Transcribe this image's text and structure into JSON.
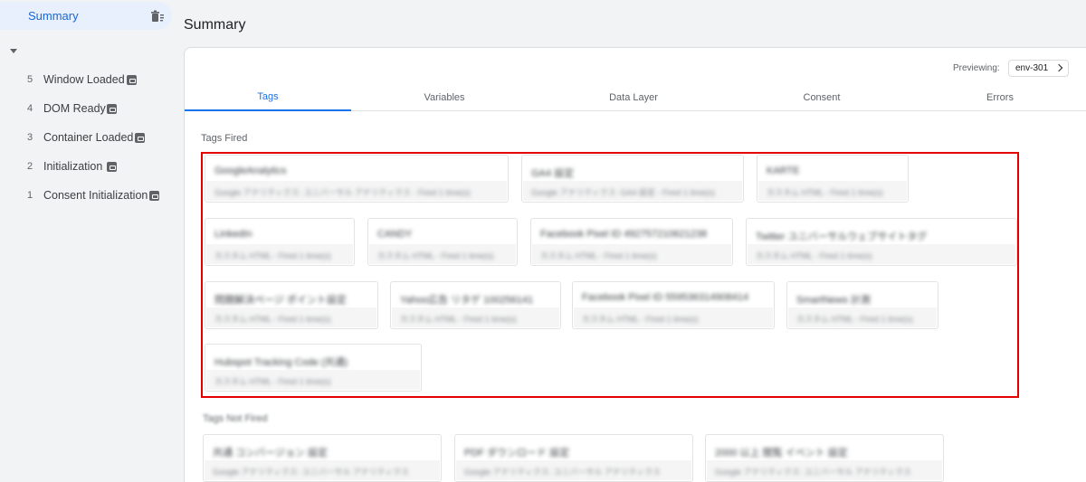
{
  "sidebar": {
    "summary_label": "Summary",
    "events": [
      {
        "num": "5",
        "name": "Window Loaded"
      },
      {
        "num": "4",
        "name": "DOM Ready"
      },
      {
        "num": "3",
        "name": "Container Loaded"
      },
      {
        "num": "2",
        "name": "Initialization"
      },
      {
        "num": "1",
        "name": "Consent Initialization"
      }
    ]
  },
  "main": {
    "title": "Summary",
    "previewing_label": "Previewing:",
    "env_name": "env-301",
    "tabs": [
      {
        "label": "Tags",
        "active": true
      },
      {
        "label": "Variables"
      },
      {
        "label": "Data Layer"
      },
      {
        "label": "Consent"
      },
      {
        "label": "Errors"
      }
    ],
    "tags_fired_title": "Tags Fired",
    "tags_fired": [
      {
        "name": "GoogleAnalytics",
        "desc": "Google アナリティクス: ユニバーサル アナリティクス - Fired 1 time(s)"
      },
      {
        "name": "GA4 設定",
        "desc": "Google アナリティクス: GA4 設定 - Fired 1 time(s)"
      },
      {
        "name": "KARTE",
        "desc": "カスタム HTML - Fired 1 time(s)"
      },
      {
        "name": "LinkedIn",
        "desc": "カスタム HTML - Fired 1 time(s)"
      },
      {
        "name": "CANDY",
        "desc": "カスタム HTML - Fired 1 time(s)"
      },
      {
        "name": "Facebook Pixel ID 492757210621238",
        "desc": "カスタム HTML - Fired 1 time(s)"
      },
      {
        "name": "Twitter ユニバーサルウェブサイトタグ",
        "desc": "カスタム HTML - Fired 1 time(s)"
      },
      {
        "name": "問題解決ページ ポイント設定",
        "desc": "カスタム HTML - Fired 1 time(s)"
      },
      {
        "name": "Yahoo広告 リタゲ 100256141",
        "desc": "カスタム HTML - Fired 1 time(s)"
      },
      {
        "name": "Facebook Pixel ID 559536314908414",
        "desc": "カスタム HTML - Fired 1 time(s)"
      },
      {
        "name": "SmartNews 計測",
        "desc": "カスタム HTML - Fired 1 time(s)"
      },
      {
        "name": "Hubspot Tracking Code (共通)",
        "desc": "カスタム HTML - Fired 1 time(s)"
      }
    ],
    "tags_not_fired_title": "Tags Not Fired",
    "tags_not_fired": [
      {
        "name": "共通 コンバージョン 設定",
        "desc": "Google アナリティクス: ユニバーサル アナリティクス"
      },
      {
        "name": "PDF ダウンロード 設定",
        "desc": "Google アナリティクス: ユニバーサル アナリティクス"
      },
      {
        "name": "2000 以上 閲覧 イベント 設定",
        "desc": "Google アナリティクス: ユニバーサル アナリティクス"
      }
    ]
  }
}
